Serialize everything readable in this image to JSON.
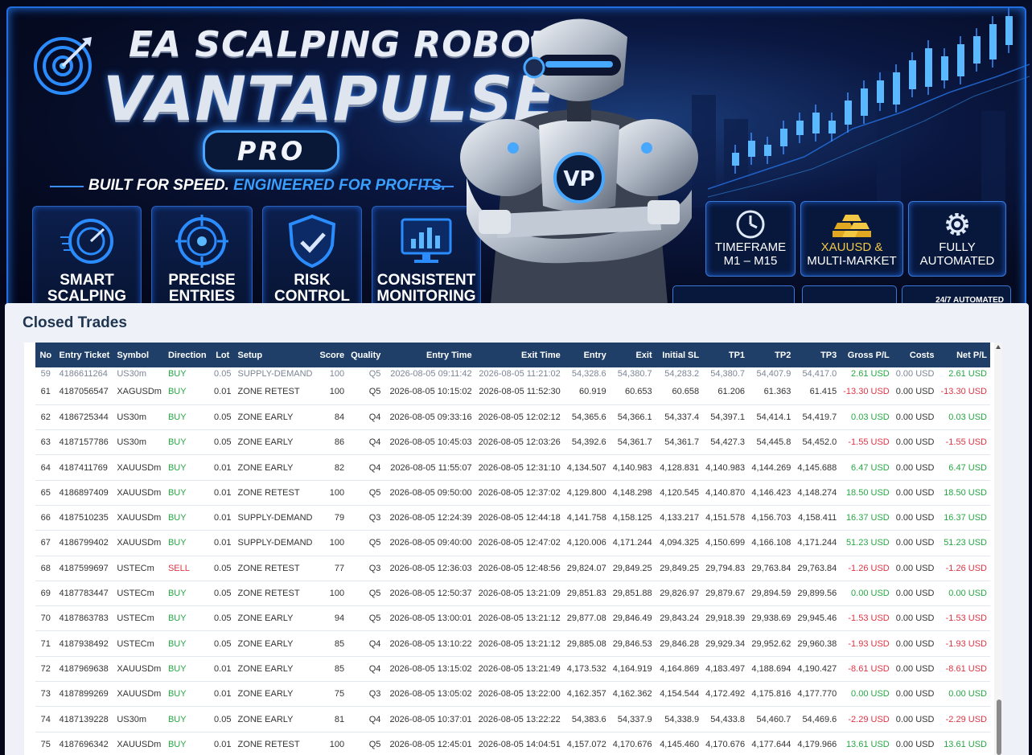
{
  "banner": {
    "title_small": "EA SCALPING ROBOT",
    "title_big": "VANTAPULSE",
    "badge": "PRO",
    "tagline_main": "BUILT FOR SPEED.",
    "tagline_accent": "ENGINEERED FOR PROFITS.",
    "robot_emblem": "VP",
    "features": [
      {
        "line1": "SMART",
        "line2": "SCALPING",
        "icon": "speedometer-icon"
      },
      {
        "line1": "PRECISE",
        "line2": "ENTRIES",
        "icon": "crosshair-icon"
      },
      {
        "line1": "RISK",
        "line2": "CONTROL",
        "icon": "shield-check-icon"
      },
      {
        "line1": "CONSISTENT",
        "line2": "MONITORING",
        "icon": "monitor-chart-icon"
      }
    ],
    "info": [
      {
        "line1": "TIMEFRAME",
        "line2": "M1 – M15",
        "icon": "clock-icon"
      },
      {
        "line1": "XAUUSD &",
        "line2": "MULTI-MARKET",
        "icon": "gold-bars-icon"
      },
      {
        "line1": "FULLY",
        "line2": "AUTOMATED",
        "icon": "gear-icon"
      }
    ],
    "mini_label": "24/7 AUTOMATED"
  },
  "panel": {
    "title": "Closed Trades",
    "ghost_row": [
      "59",
      "4186611264",
      "US30m",
      "BUY",
      "0.05",
      "SUPPLY-DEMAND",
      "100",
      "Q5",
      "2026-08-05 09:11:42",
      "2026-08-05 11:21:02",
      "54,328.6",
      "54,380.7",
      "54,283.2",
      "54,380.7",
      "54,407.9",
      "54,417.0",
      "2.61 USD",
      "0.00 USD",
      "2.61 USD"
    ],
    "columns": [
      "No",
      "Entry Ticket",
      "Symbol",
      "Direction",
      "Lot",
      "Setup",
      "Score",
      "Quality",
      "Entry Time",
      "Exit Time",
      "Entry",
      "Exit",
      "Initial SL",
      "TP1",
      "TP2",
      "TP3",
      "Gross P/L",
      "Costs",
      "Net P/L"
    ],
    "rows": [
      [
        "61",
        "4187056547",
        "XAGUSDm",
        "BUY",
        "0.01",
        "ZONE RETEST",
        "100",
        "Q5",
        "2026-08-05 10:15:02",
        "2026-08-05 11:52:30",
        "60.919",
        "60.653",
        "60.658",
        "61.206",
        "61.363",
        "61.415",
        "-13.30 USD",
        "0.00 USD",
        "-13.30 USD"
      ],
      [
        "62",
        "4186725344",
        "US30m",
        "BUY",
        "0.05",
        "ZONE EARLY",
        "84",
        "Q4",
        "2026-08-05 09:33:16",
        "2026-08-05 12:02:12",
        "54,365.6",
        "54,366.1",
        "54,337.4",
        "54,397.1",
        "54,414.1",
        "54,419.7",
        "0.03 USD",
        "0.00 USD",
        "0.03 USD"
      ],
      [
        "63",
        "4187157786",
        "US30m",
        "BUY",
        "0.05",
        "ZONE EARLY",
        "86",
        "Q4",
        "2026-08-05 10:45:03",
        "2026-08-05 12:03:26",
        "54,392.6",
        "54,361.7",
        "54,361.7",
        "54,427.3",
        "54,445.8",
        "54,452.0",
        "-1.55 USD",
        "0.00 USD",
        "-1.55 USD"
      ],
      [
        "64",
        "4187411769",
        "XAUUSDm",
        "BUY",
        "0.01",
        "ZONE EARLY",
        "82",
        "Q4",
        "2026-08-05 11:55:07",
        "2026-08-05 12:31:10",
        "4,134.507",
        "4,140.983",
        "4,128.831",
        "4,140.983",
        "4,144.269",
        "4,145.688",
        "6.47 USD",
        "0.00 USD",
        "6.47 USD"
      ],
      [
        "65",
        "4186897409",
        "XAUUSDm",
        "BUY",
        "0.01",
        "ZONE RETEST",
        "100",
        "Q5",
        "2026-08-05 09:50:00",
        "2026-08-05 12:37:02",
        "4,129.800",
        "4,148.298",
        "4,120.545",
        "4,140.870",
        "4,146.423",
        "4,148.274",
        "18.50 USD",
        "0.00 USD",
        "18.50 USD"
      ],
      [
        "66",
        "4187510235",
        "XAUUSDm",
        "BUY",
        "0.01",
        "SUPPLY-DEMAND",
        "79",
        "Q3",
        "2026-08-05 12:24:39",
        "2026-08-05 12:44:18",
        "4,141.758",
        "4,158.125",
        "4,133.217",
        "4,151.578",
        "4,156.703",
        "4,158.411",
        "16.37 USD",
        "0.00 USD",
        "16.37 USD"
      ],
      [
        "67",
        "4186799402",
        "XAUUSDm",
        "BUY",
        "0.01",
        "SUPPLY-DEMAND",
        "100",
        "Q5",
        "2026-08-05 09:40:00",
        "2026-08-05 12:47:02",
        "4,120.006",
        "4,171.244",
        "4,094.325",
        "4,150.699",
        "4,166.108",
        "4,171.244",
        "51.23 USD",
        "0.00 USD",
        "51.23 USD"
      ],
      [
        "68",
        "4187599697",
        "USTECm",
        "SELL",
        "0.05",
        "ZONE RETEST",
        "77",
        "Q3",
        "2026-08-05 12:36:03",
        "2026-08-05 12:48:56",
        "29,824.07",
        "29,849.25",
        "29,849.25",
        "29,794.83",
        "29,763.84",
        "29,763.84",
        "-1.26 USD",
        "0.00 USD",
        "-1.26 USD"
      ],
      [
        "69",
        "4187783447",
        "USTECm",
        "BUY",
        "0.05",
        "ZONE RETEST",
        "100",
        "Q5",
        "2026-08-05 12:50:37",
        "2026-08-05 13:21:09",
        "29,851.83",
        "29,851.88",
        "29,826.97",
        "29,879.67",
        "29,894.59",
        "29,899.56",
        "0.00 USD",
        "0.00 USD",
        "0.00 USD"
      ],
      [
        "70",
        "4187863783",
        "USTECm",
        "BUY",
        "0.05",
        "ZONE EARLY",
        "94",
        "Q5",
        "2026-08-05 13:00:01",
        "2026-08-05 13:21:12",
        "29,877.08",
        "29,846.49",
        "29,843.24",
        "29,918.39",
        "29,938.69",
        "29,945.46",
        "-1.53 USD",
        "0.00 USD",
        "-1.53 USD"
      ],
      [
        "71",
        "4187938492",
        "USTECm",
        "BUY",
        "0.05",
        "ZONE EARLY",
        "85",
        "Q4",
        "2026-08-05 13:10:22",
        "2026-08-05 13:21:12",
        "29,885.08",
        "29,846.53",
        "29,846.28",
        "29,929.34",
        "29,952.62",
        "29,960.38",
        "-1.93 USD",
        "0.00 USD",
        "-1.93 USD"
      ],
      [
        "72",
        "4187969638",
        "XAUUSDm",
        "BUY",
        "0.01",
        "ZONE EARLY",
        "85",
        "Q4",
        "2026-08-05 13:15:02",
        "2026-08-05 13:21:49",
        "4,173.532",
        "4,164.919",
        "4,164.869",
        "4,183.497",
        "4,188.694",
        "4,190.427",
        "-8.61 USD",
        "0.00 USD",
        "-8.61 USD"
      ],
      [
        "73",
        "4187899269",
        "XAUUSDm",
        "BUY",
        "0.01",
        "ZONE EARLY",
        "75",
        "Q3",
        "2026-08-05 13:05:02",
        "2026-08-05 13:22:00",
        "4,162.357",
        "4,162.362",
        "4,154.544",
        "4,172.492",
        "4,175.816",
        "4,177.770",
        "0.00 USD",
        "0.00 USD",
        "0.00 USD"
      ],
      [
        "74",
        "4187139228",
        "US30m",
        "BUY",
        "0.05",
        "ZONE EARLY",
        "81",
        "Q4",
        "2026-08-05 10:37:01",
        "2026-08-05 13:22:22",
        "54,383.6",
        "54,337.9",
        "54,338.9",
        "54,433.8",
        "54,460.7",
        "54,469.6",
        "-2.29 USD",
        "0.00 USD",
        "-2.29 USD"
      ],
      [
        "75",
        "4187696342",
        "XAUUSDm",
        "BUY",
        "0.01",
        "ZONE RETEST",
        "100",
        "Q5",
        "2026-08-05 12:45:01",
        "2026-08-05 14:04:51",
        "4,157.072",
        "4,170.676",
        "4,145.460",
        "4,170.676",
        "4,177.644",
        "4,179.966",
        "13.61 USD",
        "0.00 USD",
        "13.61 USD"
      ]
    ]
  },
  "colors": {
    "header_bg": "#1f3f68",
    "buy": "#28a745",
    "sell": "#dc3545",
    "profit": "#28a745",
    "loss": "#dc3545",
    "accent": "#3aa0ff"
  }
}
